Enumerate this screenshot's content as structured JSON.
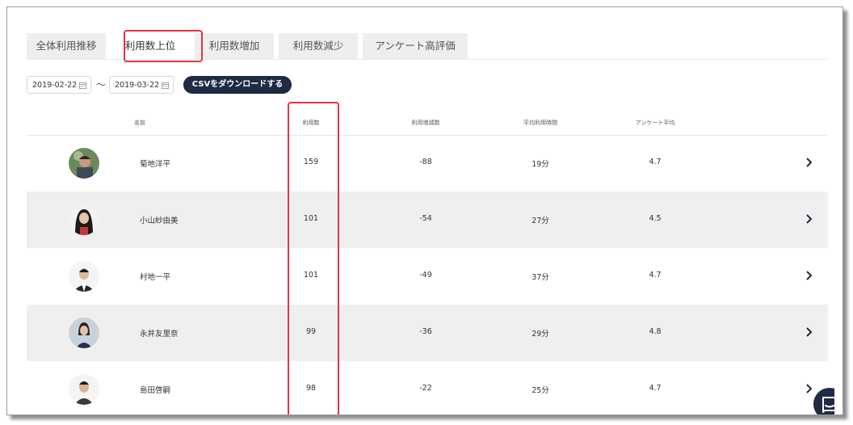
{
  "tabs": [
    {
      "label": "全体利用推移"
    },
    {
      "label": "利用数上位"
    },
    {
      "label": "利用数増加"
    },
    {
      "label": "利用数減少"
    },
    {
      "label": "アンケート高評価"
    }
  ],
  "active_tab_index": 1,
  "date_range": {
    "start": "2019-02-22",
    "separator": "〜",
    "end": "2019-03-22"
  },
  "csv_button": "CSVをダウンロードする",
  "columns": {
    "name": "名前",
    "usage": "利用数",
    "change": "利用増減数",
    "avg_time": "平均利用時間",
    "survey_avg": "アンケート平均"
  },
  "rows": [
    {
      "name": "菊地洋平",
      "usage": "159",
      "change": "-88",
      "avg_time": "19分",
      "survey": "4.7"
    },
    {
      "name": "小山紗由美",
      "usage": "101",
      "change": "-54",
      "avg_time": "27分",
      "survey": "4.5"
    },
    {
      "name": "村地一平",
      "usage": "101",
      "change": "-49",
      "avg_time": "37分",
      "survey": "4.7"
    },
    {
      "name": "永井友里奈",
      "usage": "99",
      "change": "-36",
      "avg_time": "29分",
      "survey": "4.8"
    },
    {
      "name": "島田啓嗣",
      "usage": "98",
      "change": "-22",
      "avg_time": "25分",
      "survey": "4.7"
    }
  ],
  "colors": {
    "accent": "#1f2a44",
    "highlight": "#e8333f",
    "row_alt": "#efefef"
  }
}
